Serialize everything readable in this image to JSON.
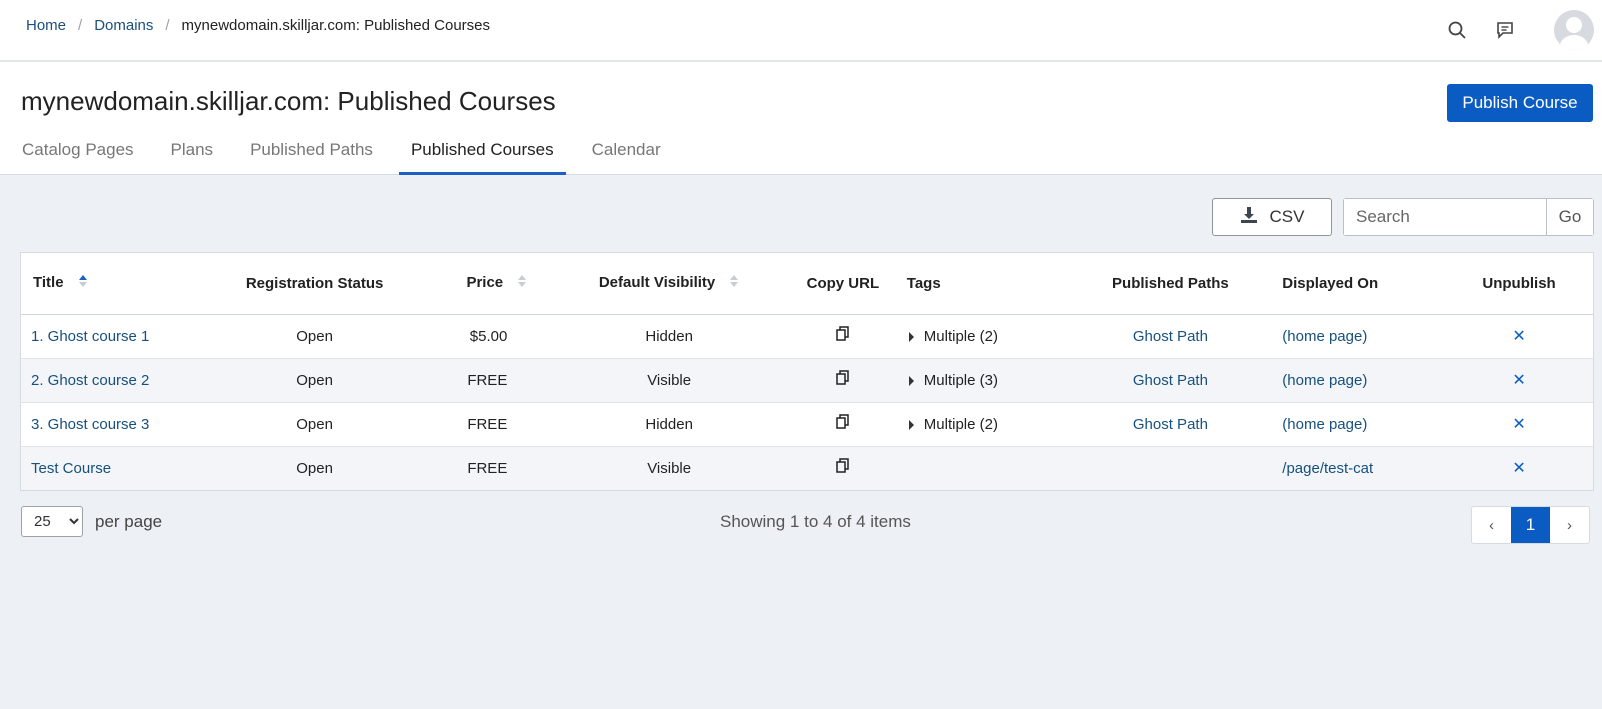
{
  "breadcrumb": {
    "home": "Home",
    "domains": "Domains",
    "current": "mynewdomain.skilljar.com: Published Courses"
  },
  "header": {
    "title": "mynewdomain.skilljar.com: Published Courses",
    "publish_button": "Publish Course",
    "tabs": [
      {
        "label": "Catalog Pages"
      },
      {
        "label": "Plans"
      },
      {
        "label": "Published Paths"
      },
      {
        "label": "Published Courses",
        "active": true
      },
      {
        "label": "Calendar"
      }
    ]
  },
  "toolbar": {
    "csv_label": "CSV",
    "search_placeholder": "Search",
    "go_label": "Go"
  },
  "table": {
    "columns": [
      "Title",
      "Registration Status",
      "Price",
      "Default Visibility",
      "Copy URL",
      "Tags",
      "Published Paths",
      "Displayed On",
      "Unpublish"
    ],
    "rows": [
      {
        "title": "1. Ghost course 1",
        "status": "Open",
        "price": "$5.00",
        "visibility": "Hidden",
        "tags": "Multiple (2)",
        "path": "Ghost Path",
        "displayed": "(home page)",
        "unpublish": "✕"
      },
      {
        "title": "2. Ghost course 2",
        "status": "Open",
        "price": "FREE",
        "visibility": "Visible",
        "tags": "Multiple (3)",
        "path": "Ghost Path",
        "displayed": "(home page)",
        "unpublish": "✕"
      },
      {
        "title": "3. Ghost course 3",
        "status": "Open",
        "price": "FREE",
        "visibility": "Hidden",
        "tags": "Multiple (2)",
        "path": "Ghost Path",
        "displayed": "(home page)",
        "unpublish": "✕"
      },
      {
        "title": "Test Course",
        "status": "Open",
        "price": "FREE",
        "visibility": "Visible",
        "tags": "",
        "path": "",
        "displayed": "/page/test-cat",
        "unpublish": "✕"
      }
    ]
  },
  "footer": {
    "per_page_value": "25",
    "per_page_label": "per page",
    "showing": "Showing 1 to 4 of 4 items",
    "prev": "‹",
    "page": "1",
    "next": "›"
  },
  "colors": {
    "accent": "#0a5cc2",
    "link": "#17507e",
    "background": "#edf1f5"
  }
}
